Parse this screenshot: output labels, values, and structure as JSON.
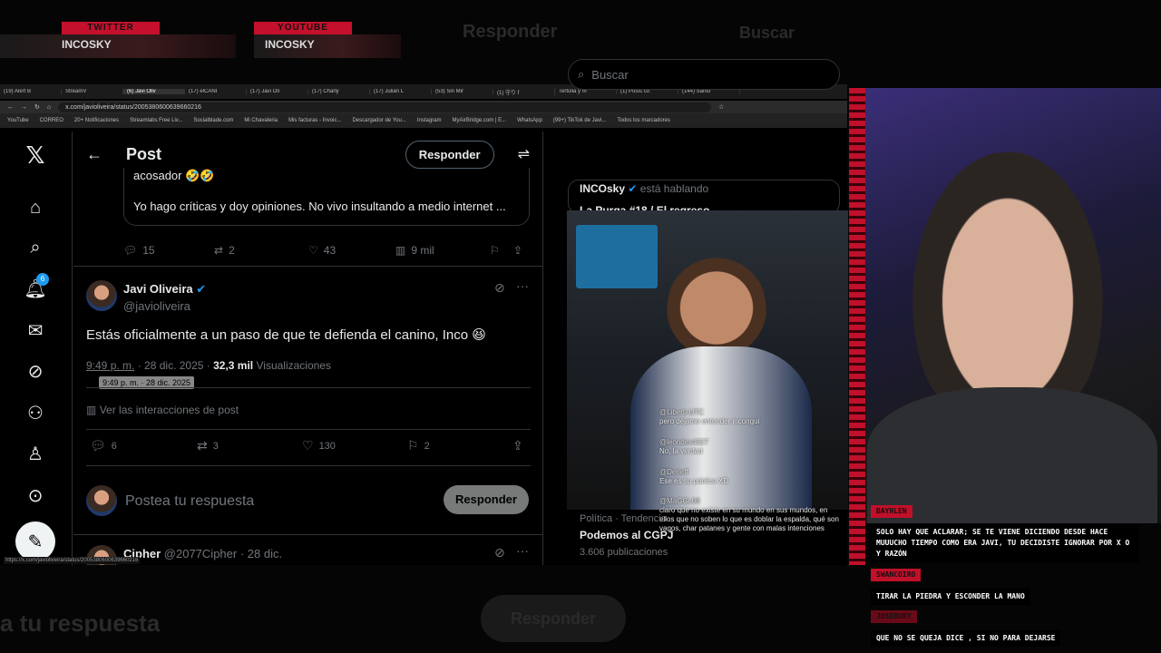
{
  "overlay": {
    "twitter_label": "TWITTER",
    "twitter_handle": "INCOSKY",
    "youtube_label": "YOUTUBE",
    "youtube_handle": "INCOSKY",
    "ghost_responder": "Responder",
    "ghost_buscar": "Buscar",
    "ghost_respuesta": "a tu respuesta",
    "ghost_responder2": "Responder"
  },
  "browser": {
    "tabs": [
      "(19) Alert B",
      "StreamV",
      "(6) Javi Oliv",
      "(17) elCANI",
      "(17) Javi Oli",
      "(17) Charly",
      "(17) Julian L",
      "(53) Sin Mir",
      "(1) 守り f",
      "Tertulia y m",
      "(1) Posts co",
      "(144) Santo"
    ],
    "url": "x.com/javioliveira/status/2005380600639660216",
    "bookmarks": [
      "YouTube",
      "CORREO",
      "20+ Notificaciones",
      "Streamlabs Free Liv...",
      "Socialblade.com",
      "Mi Chavaleria",
      "Mis facturas - Invoic...",
      "Descargador de You...",
      "Instagram",
      "MyAirBridge.com | E...",
      "WhatsApp",
      "(99+) TikTok de Javi...",
      "Todos los marcadores"
    ],
    "status_url": "https://x.com/javioliveira/status/2005380600639660216"
  },
  "nav": {
    "notification_count": "6"
  },
  "post_page": {
    "back": "←",
    "title": "Post",
    "responder_button": "Responder",
    "quote_text_1": "acosador 🤣🤣",
    "quote_text_2": "Yo hago críticas y doy opiniones. No vivo insultando a medio internet ...",
    "prev_stats": {
      "replies": "15",
      "reposts": "2",
      "likes": "43",
      "views": "9 mil"
    },
    "author_name": "Javi Oliveira",
    "author_handle": "@javioliveira",
    "post_text": "Estás oficialmente a un paso de que te defienda el canino, Inco 😆",
    "time": "9:49 p. m.",
    "date": "· 28 dic. 2025 ·",
    "views_count": "32,3 mil",
    "views_label": "Visualizaciones",
    "tooltip": "9:49 p. m. · 28 dic. 2025",
    "interactions": "Ver las interacciones de post",
    "stats": {
      "replies": "6",
      "reposts": "3",
      "likes": "130",
      "bookmarks": "2"
    },
    "reply_placeholder": "Postea tu respuesta",
    "reply_button": "Responder",
    "next_author": "Cipher",
    "next_handle": "@2077Cipher · 28 dic."
  },
  "sidebar": {
    "search_placeholder": "Buscar",
    "space_host": "INCOsky",
    "space_status": "está hablando",
    "space_title": "La Purga #18 / El regreso",
    "trend_category": "Política · Tendencia",
    "trend_title": "Podemos al CGPJ",
    "trend_count": "3.606 publicaciones"
  },
  "video_chat": [
    {
      "name": "@Liberti-UTC",
      "text": "pero déjame entender incongui"
    },
    {
      "name": "@leondex4327",
      "text": "No, la verdad"
    },
    {
      "name": "@Derleff",
      "text": "Ese es su público XD"
    },
    {
      "name": "@MaGGi.08",
      "text": "claro que no existe en su mundo en sus mundos, en ellos que no soben lo que es doblar la espalda, qué son vagos, char patanes y gente con malas intenciones"
    }
  ],
  "stream_chat": [
    {
      "name": "BAYHLEN",
      "text": "SOLO HAY QUE ACLARAR; SE TE VIENE DICIENDO DESDE HACE MUUUCHO TIEMPO COMO ERA JAVI, TU DECIDISTE IGNORAR POR X O Y RAZÓN"
    },
    {
      "name": "SWANCOIRO",
      "text": "TIRAR LA PIEDRA Y ESCONDER LA MANO"
    },
    {
      "name": "JOSEBURY",
      "text": "QUE NO SE QUEJA DICE , SI NO PARA DEJARSE"
    }
  ],
  "colors": {
    "accent": "#1d9bf0",
    "stream_red": "#c0102a",
    "bg": "#000000",
    "text": "#e7e9ea",
    "muted": "#71767b"
  }
}
